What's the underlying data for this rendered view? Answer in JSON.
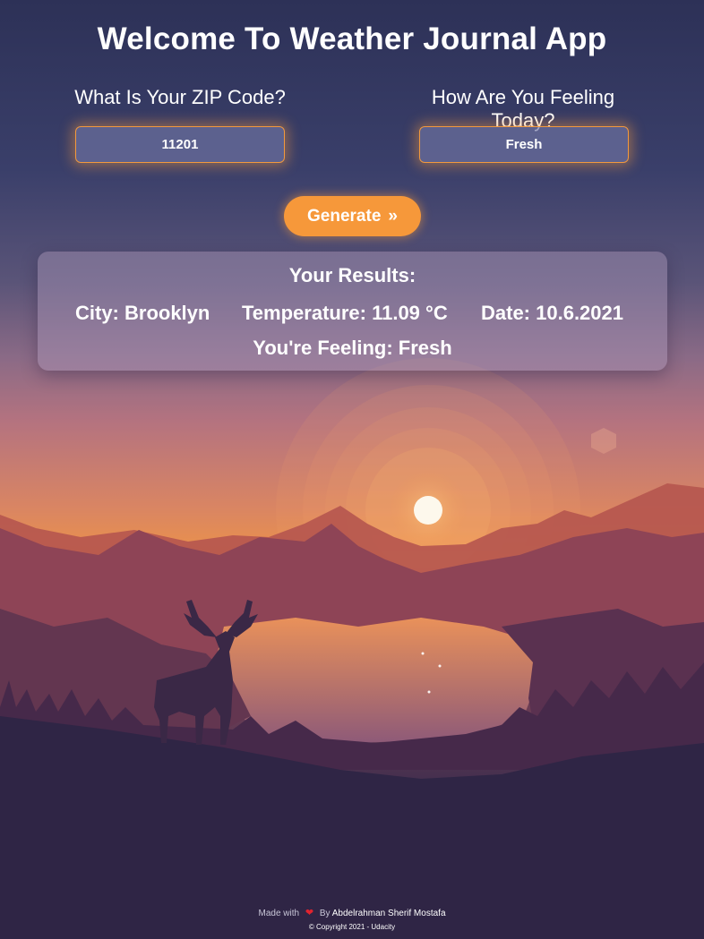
{
  "header": {
    "title": "Welcome To Weather Journal App"
  },
  "form": {
    "zip_label": "What Is Your ZIP Code?",
    "zip_value": "11201",
    "feeling_label": "How Are You Feeling Today?",
    "feeling_value": "Fresh",
    "generate_label": "Generate",
    "generate_icon": "»"
  },
  "results": {
    "title": "Your Results:",
    "city": "City: Brooklyn",
    "temperature": "Temperature: 11.09 °C",
    "date": "Date: 10.6.2021",
    "feeling": "You're Feeling: Fresh"
  },
  "footer": {
    "made_with": "Made with",
    "heart_icon": "heart-icon",
    "by": "By",
    "author": "Abdelrahman Sherif Mostafa",
    "copyright": "© Copyright 2021 - Udacity"
  },
  "colors": {
    "accent": "#f6983a",
    "heart": "#e0232e",
    "sky_top": "#2d3157"
  }
}
